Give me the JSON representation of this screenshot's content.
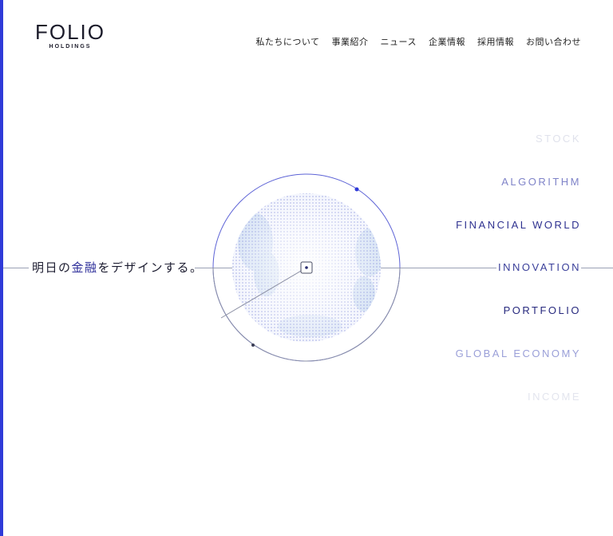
{
  "logo": {
    "main": "FOLIO",
    "sub": "HOLDINGS"
  },
  "nav": {
    "items": [
      "私たちについて",
      "事業紹介",
      "ニュース",
      "企業情報",
      "採用情報",
      "お問い合わせ"
    ]
  },
  "hero": {
    "tagline_part1": "明日の",
    "tagline_highlight": "金融",
    "tagline_part2": "をデザインする。"
  },
  "keywords": [
    {
      "text": "STOCK",
      "color": "#e0e2ec"
    },
    {
      "text": "ALGORITHM",
      "color": "#7f83c8"
    },
    {
      "text": "FINANCIAL WORLD",
      "color": "#2f3290"
    },
    {
      "text": "INNOVATION",
      "color": "#3a3f9a"
    },
    {
      "text": "PORTFOLIO",
      "color": "#27297e"
    },
    {
      "text": "GLOBAL ECONOMY",
      "color": "#9a9fd8"
    },
    {
      "text": "INCOME",
      "color": "#e3e5ee"
    }
  ],
  "colors": {
    "accent": "#2f3ad8",
    "text": "#1b1b2a",
    "ring": "#5d63d6"
  }
}
